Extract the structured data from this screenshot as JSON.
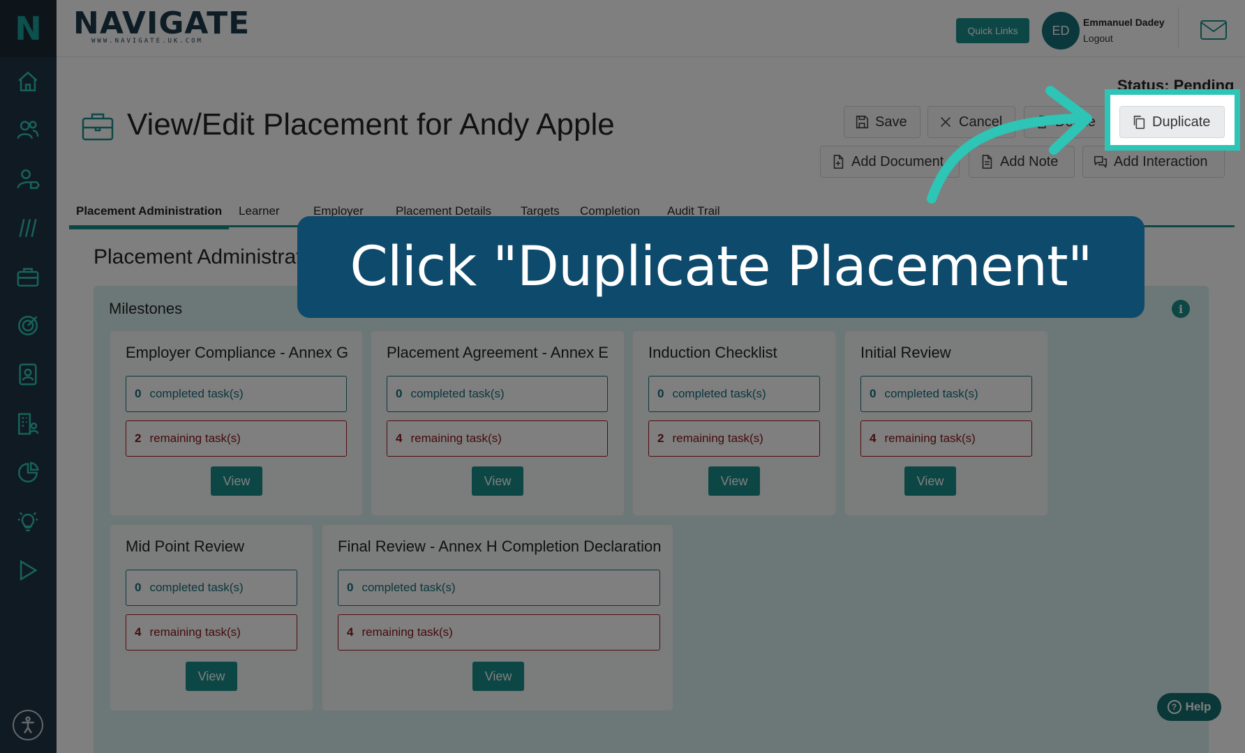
{
  "sidebar": {
    "logo_letter": "N",
    "icons": [
      "home-icon",
      "people-icon",
      "user-tag-icon",
      "slashes-icon",
      "briefcase-icon",
      "target-icon",
      "contact-card-icon",
      "building-user-icon",
      "pie-chart-icon",
      "lightbulb-icon",
      "play-icon"
    ],
    "accessibility_icon": "accessibility-icon"
  },
  "header": {
    "brand": {
      "name": "NAVIGATE",
      "url": "WWW.NAVIGATE.UK.COM"
    },
    "quick_links": "Quick Links",
    "user": {
      "initials": "ED",
      "name": "Emmanuel Dadey",
      "logout": "Logout"
    }
  },
  "page": {
    "status": "Status: Pending",
    "title": "View/Edit Placement for Andy Apple",
    "actions": {
      "save": "Save",
      "cancel": "Cancel",
      "delete": "Delete",
      "duplicate": "Duplicate",
      "add_document": "Add Document",
      "add_note": "Add Note",
      "add_interaction": "Add Interaction"
    },
    "tabs": [
      "Placement Administration",
      "Learner",
      "Employer",
      "Placement Details",
      "Targets",
      "Completion",
      "Audit Trail"
    ],
    "section_title": "Placement Administration",
    "panel_title": "Milestones",
    "completed_label": "completed task(s)",
    "remaining_label": "remaining task(s)",
    "view_label": "View",
    "milestones": [
      {
        "title": "Employer Compliance - Annex G",
        "completed": "0",
        "remaining": "2"
      },
      {
        "title": "Placement Agreement - Annex E",
        "completed": "0",
        "remaining": "4"
      },
      {
        "title": "Induction Checklist",
        "completed": "0",
        "remaining": "2"
      },
      {
        "title": "Initial Review",
        "completed": "0",
        "remaining": "4"
      },
      {
        "title": "Mid Point Review",
        "completed": "0",
        "remaining": "4"
      },
      {
        "title": "Final Review - Annex H Completion Declaration",
        "completed": "0",
        "remaining": "4"
      }
    ],
    "help": "Help"
  },
  "overlay": {
    "instruction": "Click \"Duplicate Placement\""
  },
  "colors": {
    "accent": "#1a8f8a",
    "highlight": "#2ec4b6",
    "sidebar": "#213444",
    "callout": "#0d4a6b",
    "remaining": "#a5171d"
  }
}
